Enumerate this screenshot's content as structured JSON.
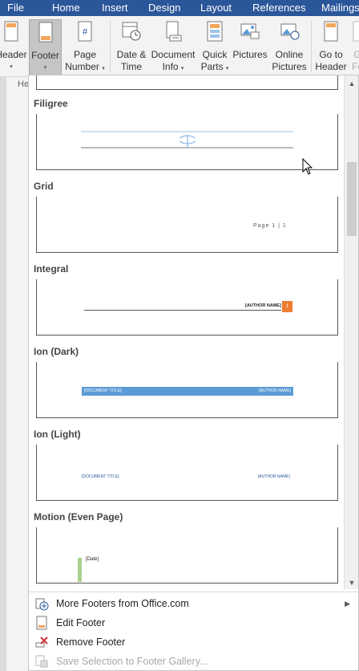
{
  "ribbon_tabs": [
    "File",
    "Home",
    "Insert",
    "Design",
    "Layout",
    "References",
    "Mailings"
  ],
  "ribbon_buttons": {
    "header": "Header",
    "footer": "Footer",
    "page_number_1": "Page",
    "page_number_2": "Number",
    "date_time_1": "Date &",
    "date_time_2": "Time",
    "doc_info_1": "Document",
    "doc_info_2": "Info",
    "quick_parts_1": "Quick",
    "quick_parts_2": "Parts",
    "pictures": "Pictures",
    "online_pictures_1": "Online",
    "online_pictures_2": "Pictures",
    "go_to_header_1": "Go to",
    "go_to_header_2": "Header",
    "cut_1": "G",
    "cut_2": "Fo"
  },
  "ruler_label": "He",
  "gallery": {
    "sections": [
      {
        "title": "Filigree"
      },
      {
        "title": "Grid",
        "preview_text": "Page 1 | 1"
      },
      {
        "title": "Integral",
        "preview_text": "[AUTHOR NAME]",
        "badge": "1"
      },
      {
        "title": "Ion (Dark)",
        "left_text": "[DOCUMENT TITLE]",
        "right_text": "[AUTHOR NAME]"
      },
      {
        "title": "Ion (Light)",
        "left_text": "[DOCUMENT TITLE]",
        "right_text": "[AUTHOR NAME]"
      },
      {
        "title": "Motion (Even Page)",
        "preview_text": "[Date]"
      }
    ]
  },
  "menu": {
    "more_footers": "More Footers from Office.com",
    "edit_footer": "Edit Footer",
    "remove_footer": "Remove Footer",
    "save_selection": "Save Selection to Footer Gallery..."
  },
  "colors": {
    "ribbon_blue": "#2b579a",
    "ion_dark_bar": "#5b9bd5",
    "integral_orange": "#ed7d31",
    "motion_green": "#a9d18e"
  }
}
